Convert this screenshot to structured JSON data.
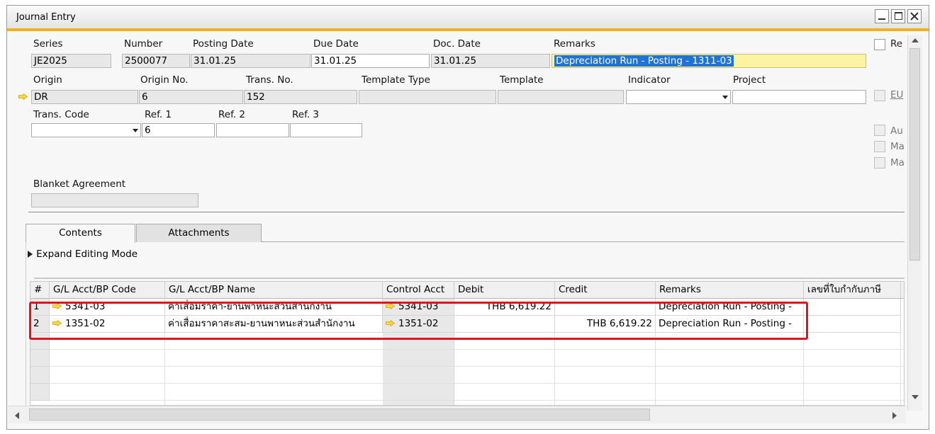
{
  "window": {
    "title": "Journal Entry"
  },
  "header": {
    "series": {
      "label": "Series",
      "value": "JE2025"
    },
    "number": {
      "label": "Number",
      "value": "2500077"
    },
    "posting_date": {
      "label": "Posting Date",
      "value": "31.01.25"
    },
    "due_date": {
      "label": "Due Date",
      "value": "31.01.25"
    },
    "doc_date": {
      "label": "Doc. Date",
      "value": "31.01.25"
    },
    "remarks": {
      "label": "Remarks",
      "value": "Depreciation Run - Posting - 1311-03"
    },
    "origin": {
      "label": "Origin",
      "value": "DR"
    },
    "origin_no": {
      "label": "Origin No.",
      "value": "6"
    },
    "trans_no": {
      "label": "Trans. No.",
      "value": "152"
    },
    "template_type": {
      "label": "Template Type",
      "value": ""
    },
    "template": {
      "label": "Template",
      "value": ""
    },
    "indicator": {
      "label": "Indicator",
      "value": ""
    },
    "project": {
      "label": "Project",
      "value": ""
    },
    "trans_code": {
      "label": "Trans. Code",
      "value": ""
    },
    "ref1": {
      "label": "Ref. 1",
      "value": "6"
    },
    "ref2": {
      "label": "Ref. 2",
      "value": ""
    },
    "ref3": {
      "label": "Ref. 3",
      "value": ""
    },
    "blanket_agreement": {
      "label": "Blanket Agreement",
      "value": ""
    }
  },
  "checkboxes": {
    "re": "Re",
    "eu": "EU",
    "au": "Au",
    "ma1": "Ma",
    "ma2": "Ma"
  },
  "tabs": {
    "contents": "Contents",
    "attachments": "Attachments"
  },
  "expand_editing_mode": "Expand Editing Mode",
  "grid": {
    "columns": [
      "#",
      "G/L Acct/BP Code",
      "G/L Acct/BP Name",
      "Control Acct",
      "Debit",
      "Credit",
      "Remarks",
      "เลขที่ใบกำกับภาษี"
    ],
    "rows": [
      {
        "num": "1",
        "code": "5341-03",
        "name": "ค่าเสื่อมราคา-ยานพาหนะส่วนสำนักงาน",
        "control": "5341-03",
        "debit": "THB 6,619.22",
        "credit": "",
        "remarks": "Depreciation Run - Posting -"
      },
      {
        "num": "2",
        "code": "1351-02",
        "name": "ค่าเสื่อมราคาสะสม-ยานพาหนะส่วนสำนักงาน",
        "control": "1351-02",
        "debit": "",
        "credit": "THB 6,619.22",
        "remarks": "Depreciation Run - Posting -"
      }
    ]
  },
  "colors": {
    "title_accent": "#f2b11f",
    "highlight_box": "#e0141e",
    "arrow": "#f5c518",
    "selection": "#1e73d6"
  }
}
